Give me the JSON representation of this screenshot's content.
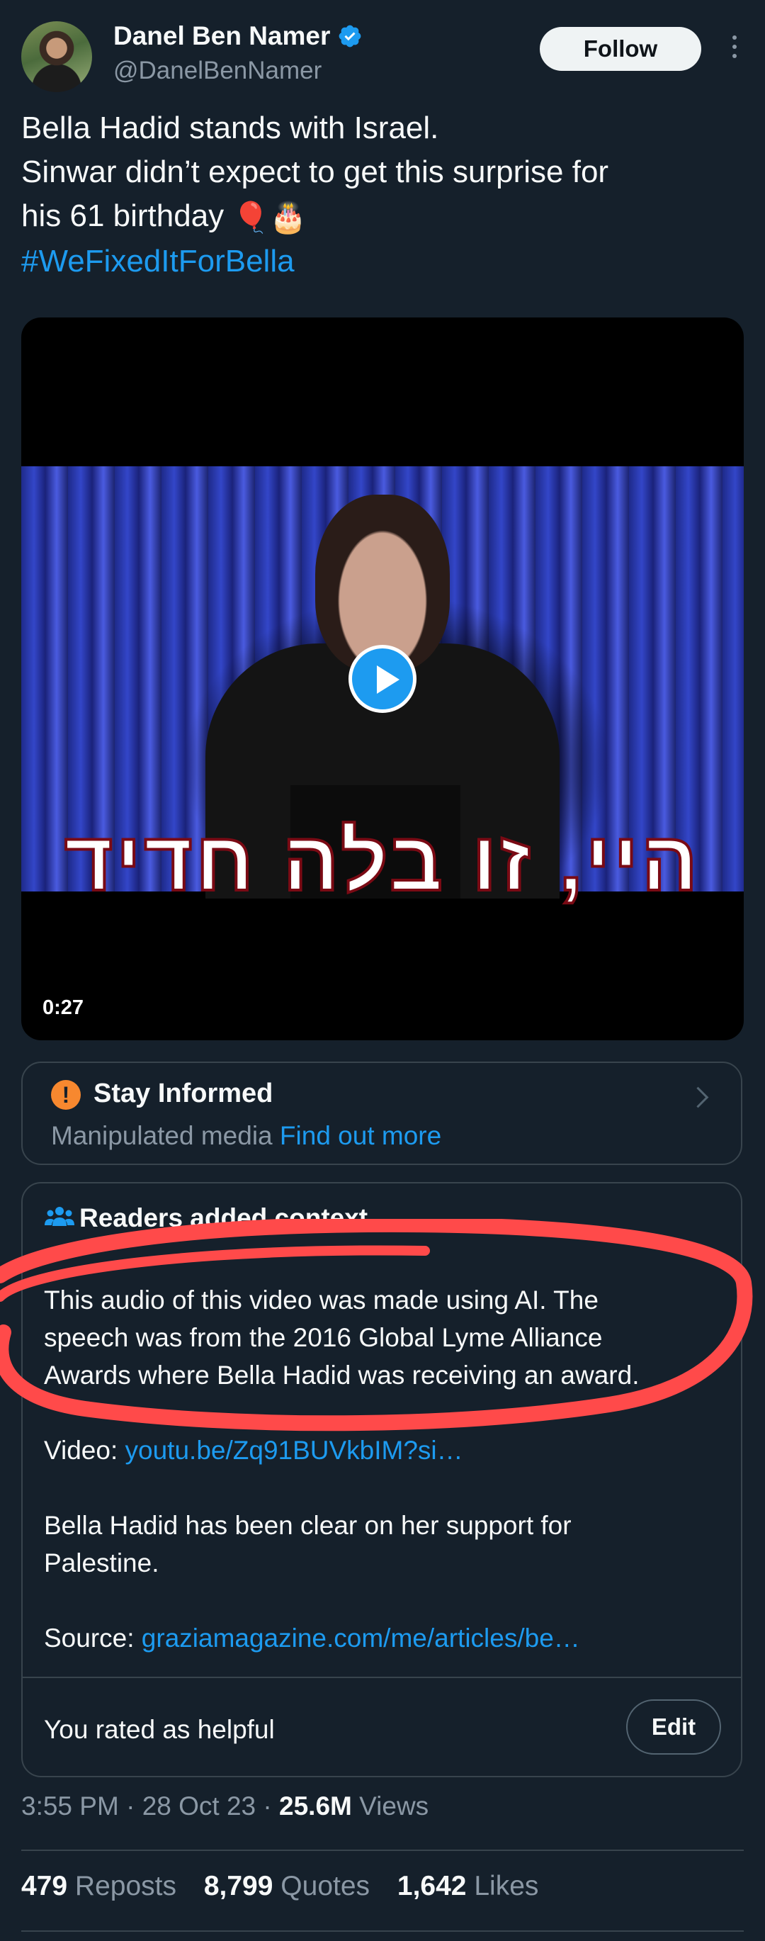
{
  "author": {
    "name": "Danel Ben Namer",
    "handle": "@DanelBenNamer",
    "verified": true
  },
  "header": {
    "follow_label": "Follow"
  },
  "tweet": {
    "lines": [
      "Bella Hadid stands with Israel.",
      "Sinwar didn’t expect to get this surprise for",
      "his 61 birthday"
    ],
    "emojis": "🎈🎂",
    "hashtag": "#WeFixedItForBella"
  },
  "media": {
    "caption": "היי, זו בלה חדיד",
    "duration": "0:27"
  },
  "stay_informed": {
    "title": "Stay Informed",
    "label": "Manipulated media",
    "link": "Find out more"
  },
  "context": {
    "title": "Readers added context",
    "highlight_lines": [
      "This audio of this video was made using AI. The",
      "speech was from the 2016 Global Lyme Alliance",
      "Awards where Bella Hadid was receiving an award."
    ],
    "video_prefix": "Video:",
    "video_link": "youtu.be/Zq91BUVkbIM?si…",
    "support_lines": [
      "Bella Hadid has been clear on her support for",
      "Palestine."
    ],
    "source_prefix": "Source:",
    "source_link": "graziamagazine.com/me/articles/be…",
    "rated_text": "You rated as helpful",
    "edit_label": "Edit"
  },
  "meta": {
    "time": "3:55 PM",
    "date": "28 Oct 23",
    "views_count": "25.6M",
    "views_label": "Views"
  },
  "stats": {
    "reposts_count": "479",
    "reposts_label": "Reposts",
    "quotes_count": "8,799",
    "quotes_label": "Quotes",
    "likes_count": "1,642",
    "likes_label": "Likes"
  },
  "colors": {
    "background": "#15202b",
    "accent": "#1d9bf0",
    "annotation": "#ff4a4a",
    "warning": "#f7882f"
  }
}
